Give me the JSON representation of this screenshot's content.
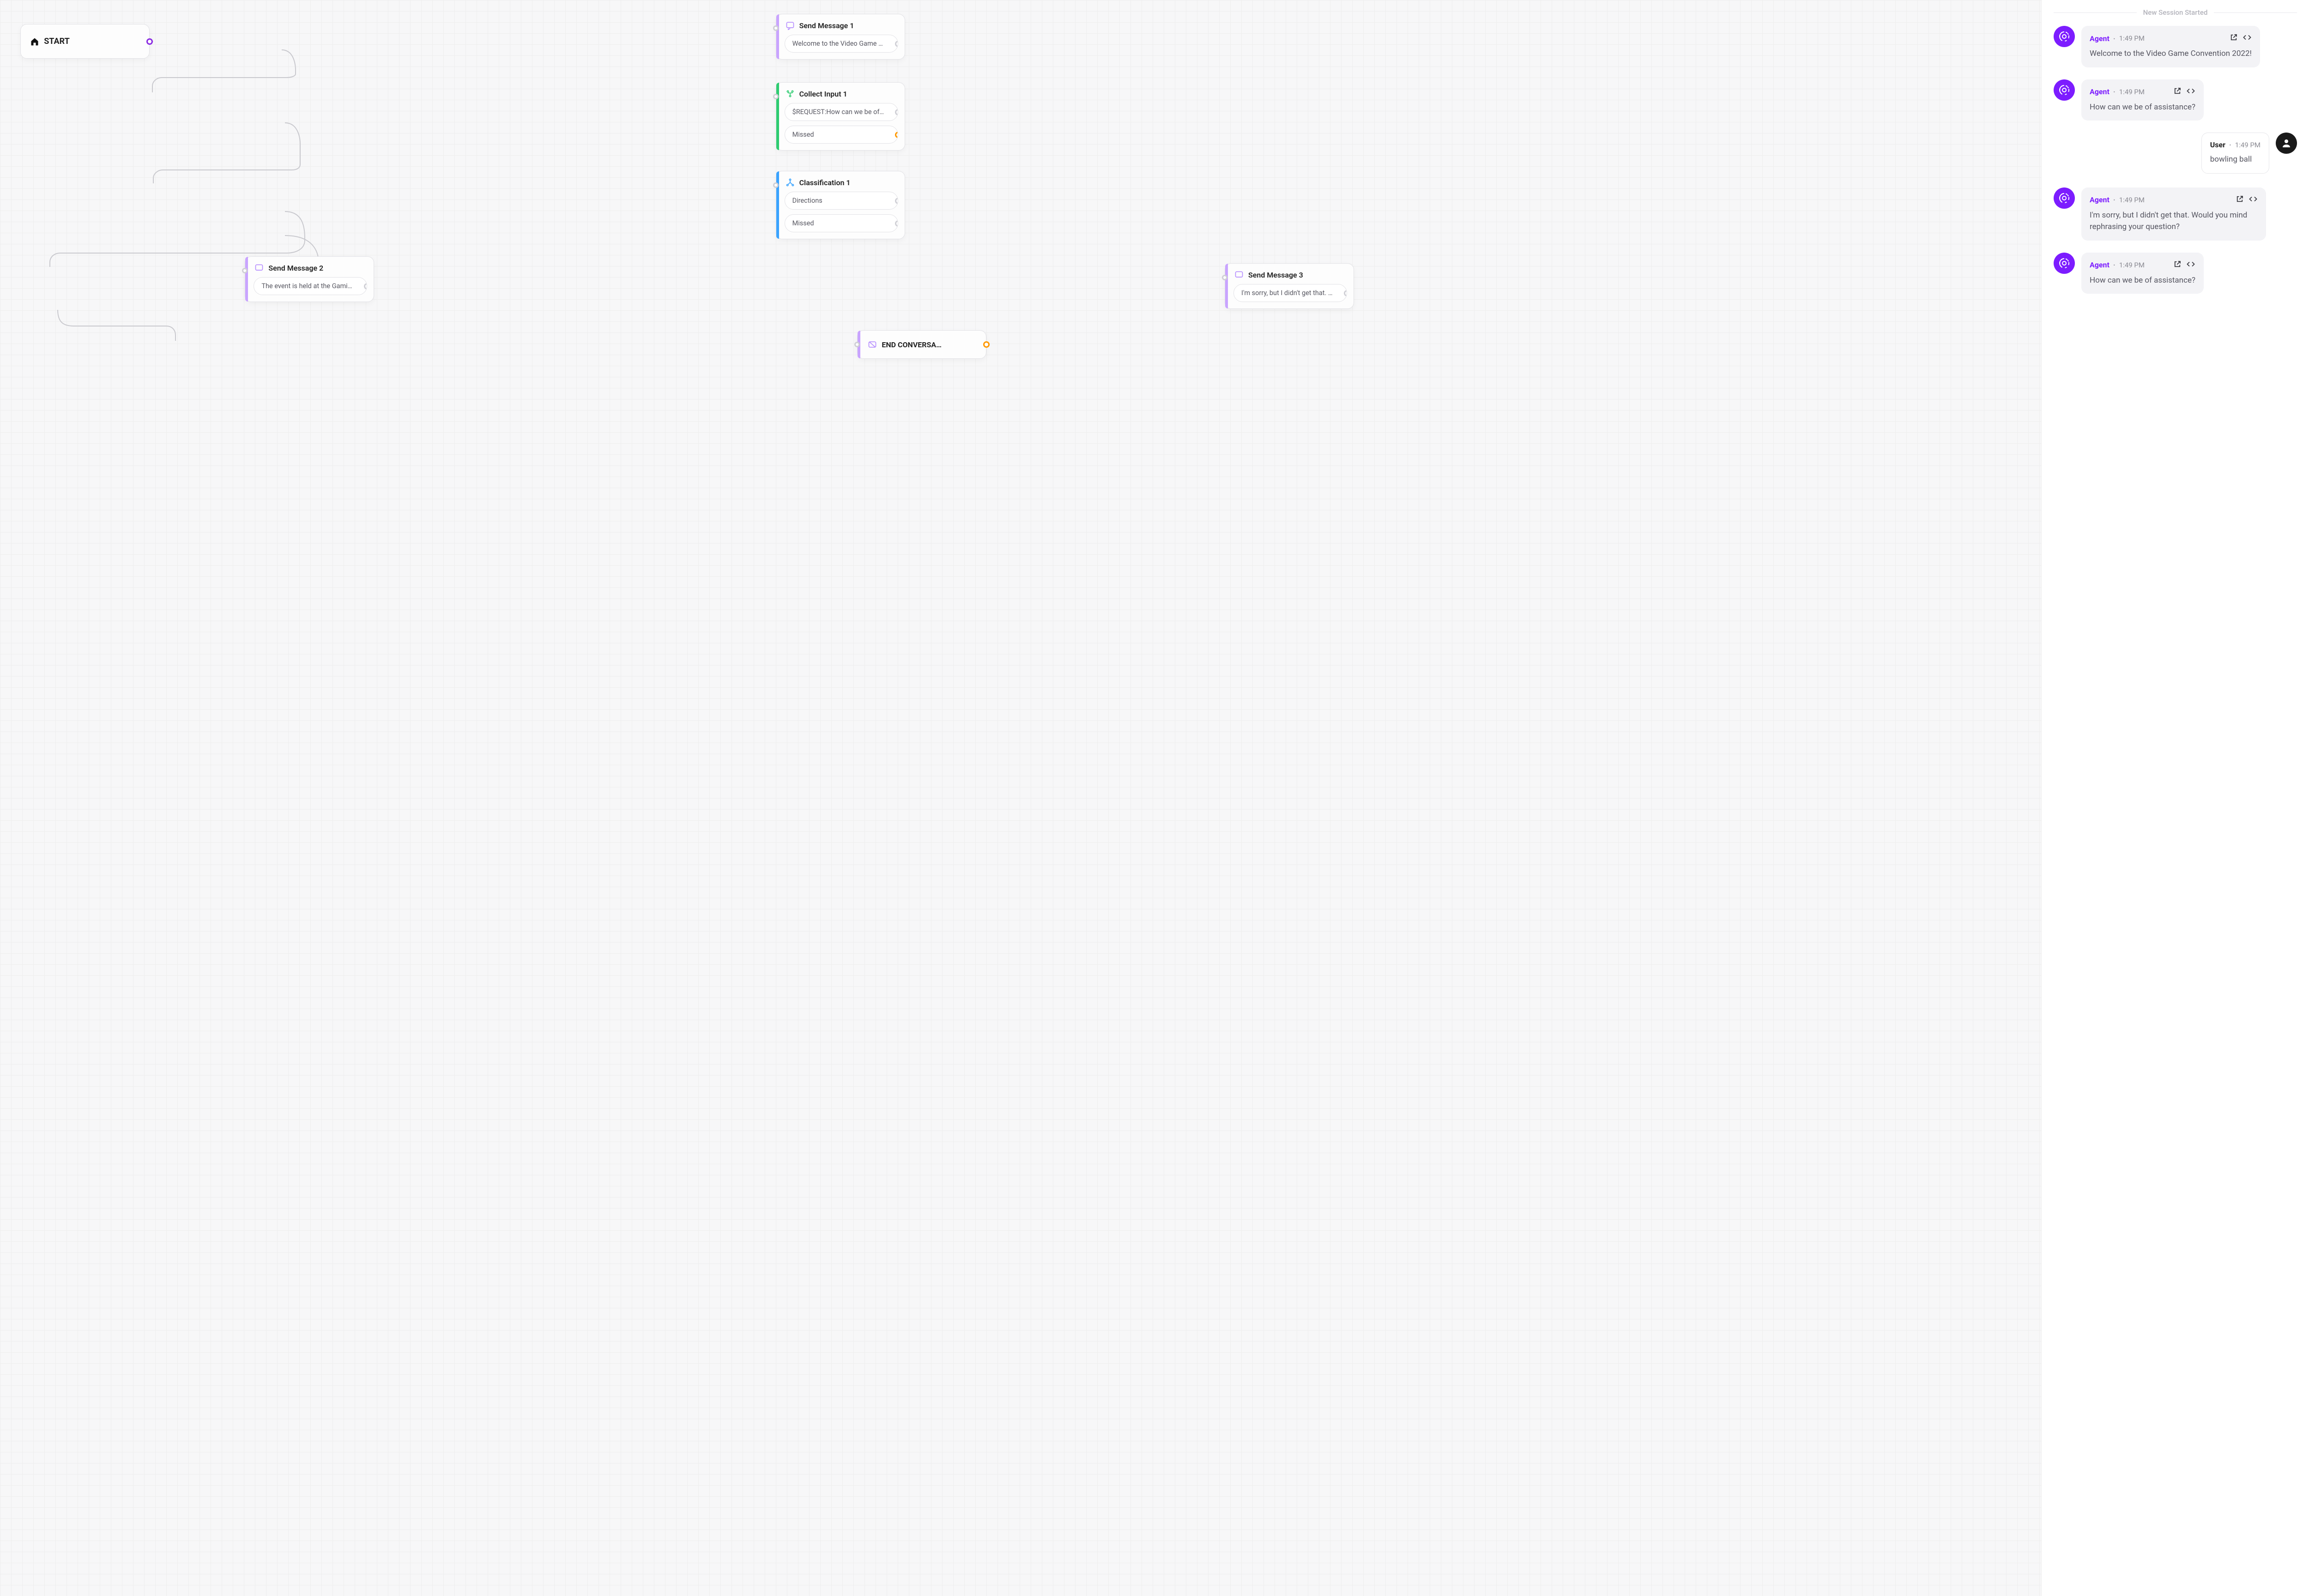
{
  "flow": {
    "start": {
      "label": "START"
    },
    "send1": {
      "title": "Send Message 1",
      "pill": "Welcome to the Video Game Co…"
    },
    "collect1": {
      "title": "Collect Input 1",
      "pill1": "$REQUEST:How can we be of assis",
      "pill2": "Missed"
    },
    "class1": {
      "title": "Classification 1",
      "pill1": "Directions",
      "pill2": "Missed"
    },
    "send2": {
      "title": "Send Message 2",
      "pill": "The event is held at the Gaming…"
    },
    "send3": {
      "title": "Send Message 3",
      "pill": "I'm sorry, but I didn't get that. …"
    },
    "end": {
      "title": "END CONVERSA…"
    }
  },
  "chat": {
    "session_header": "New Session Started",
    "agent_label": "Agent",
    "user_label": "User",
    "messages": [
      {
        "who": "agent",
        "time": "1:49 PM",
        "body": "Welcome to the Video Game Convention 2022!"
      },
      {
        "who": "agent",
        "time": "1:49 PM",
        "body": "How can we be of assistance?"
      },
      {
        "who": "user",
        "time": "1:49 PM",
        "body": "bowling ball"
      },
      {
        "who": "agent",
        "time": "1:49 PM",
        "body": "I'm sorry, but I didn't get that. Would you mind rephrasing your question?"
      },
      {
        "who": "agent",
        "time": "1:49 PM",
        "body": "How can we be of assistance?"
      }
    ]
  }
}
